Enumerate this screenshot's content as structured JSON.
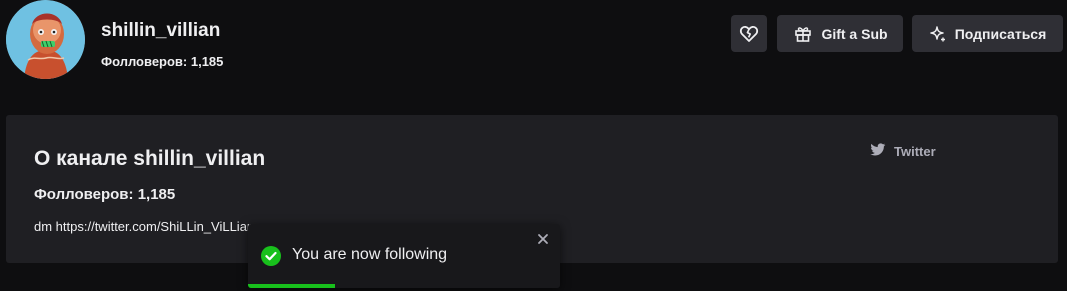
{
  "header": {
    "channel_name": "shillin_villian",
    "followers_text": "Фолловеров: 1,185"
  },
  "actions": {
    "follow_icon": "heart-broken-icon",
    "gift_label": "Gift a Sub",
    "gift_icon": "gift-icon",
    "subscribe_label": "Подписаться",
    "subscribe_icon": "sparkle-star-icon"
  },
  "about": {
    "title": "О канале shillin_villian",
    "followers_text": "Фолловеров: 1,185",
    "description": "dm https://twitter.com/ShiLLin_ViLLian",
    "social_links": [
      {
        "label": "Twitter",
        "icon": "twitter-icon"
      }
    ]
  },
  "toast": {
    "message": "You are now following",
    "status_icon": "check-circle-icon",
    "close_icon": "close-icon",
    "progress": 0.28
  },
  "colors": {
    "background": "#0e0e10",
    "panel": "#1f1f23",
    "button": "#2f2f35",
    "toast": "#18181b",
    "success": "#18c01c",
    "muted_text": "#adadb8"
  }
}
